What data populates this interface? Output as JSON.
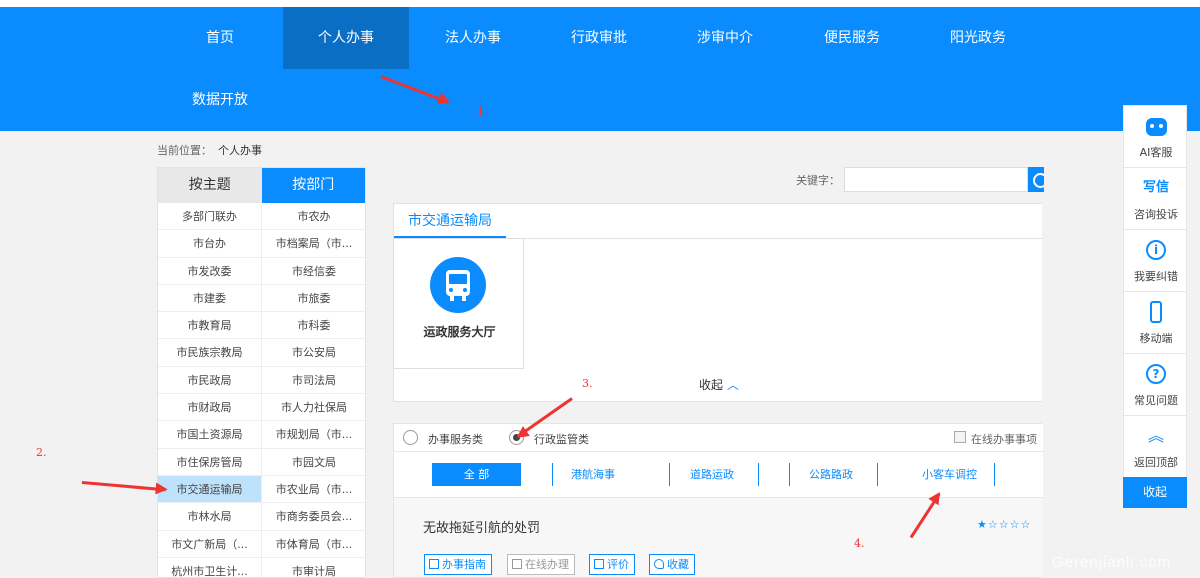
{
  "nav": {
    "items": [
      {
        "label": "首页"
      },
      {
        "label": "个人办事"
      },
      {
        "label": "法人办事"
      },
      {
        "label": "行政审批"
      },
      {
        "label": "涉审中介"
      },
      {
        "label": "便民服务"
      },
      {
        "label": "阳光政务"
      },
      {
        "label": "数据开放"
      }
    ],
    "active_index": 1
  },
  "breadcrumb": {
    "prefix": "当前位置：",
    "current": "个人办事"
  },
  "left_panel": {
    "tab_theme": "按主题",
    "tab_dept": "按部门",
    "departments": [
      "多部门联办",
      "市农办",
      "市台办",
      "市档案局（市...",
      "市发改委",
      "市经信委",
      "市建委",
      "市旅委",
      "市教育局",
      "市科委",
      "市民族宗教局",
      "市公安局",
      "市民政局",
      "市司法局",
      "市财政局",
      "市人力社保局",
      "市国土资源局",
      "市规划局（市...",
      "市住保房管局",
      "市园文局",
      "市交通运输局",
      "市农业局（市...",
      "市林水局",
      "市商务委员会...",
      "市文广新局（...",
      "市体育局（市...",
      "杭州市卫生计...",
      "市审计局"
    ],
    "selected_department": "市交通运输局"
  },
  "search": {
    "label": "关键字：",
    "placeholder": ""
  },
  "bureau": {
    "title": "市交通运输局",
    "hall_label": "运政服务大厅",
    "collapse_label": "收起"
  },
  "matters": {
    "radio_service": "办事服务类",
    "radio_admin": "行政监管类",
    "selected_radio": "行政监管类",
    "online_only_label": "在线办事事项",
    "filter_all": "全 部",
    "filters": [
      "港航海事",
      "道路运政",
      "公路路政",
      "小客车调控"
    ],
    "item_title": "无故拖延引航的处罚",
    "rating_stars": 1,
    "rating_max": 5,
    "actions": {
      "guide": "办事指南",
      "online": "在线办理",
      "evaluate": "评价",
      "favorite": "收藏"
    }
  },
  "side_bar": {
    "ai_service": "AI客服",
    "write_icon_text": "写信",
    "consult": "咨询投诉",
    "correct": "我要纠错",
    "mobile": "移动端",
    "faq": "常见问题",
    "back_top": "返回顶部",
    "collapse": "收起"
  },
  "annotations": {
    "n1": "1.",
    "n2": "2.",
    "n3": "3.",
    "n4": "4."
  },
  "watermark": "Gerenjianli.com",
  "colors": {
    "primary": "#0a8cff",
    "nav_active": "#0a6ec4",
    "selected_row": "#bfe2fb",
    "annotation": "#e33333"
  }
}
